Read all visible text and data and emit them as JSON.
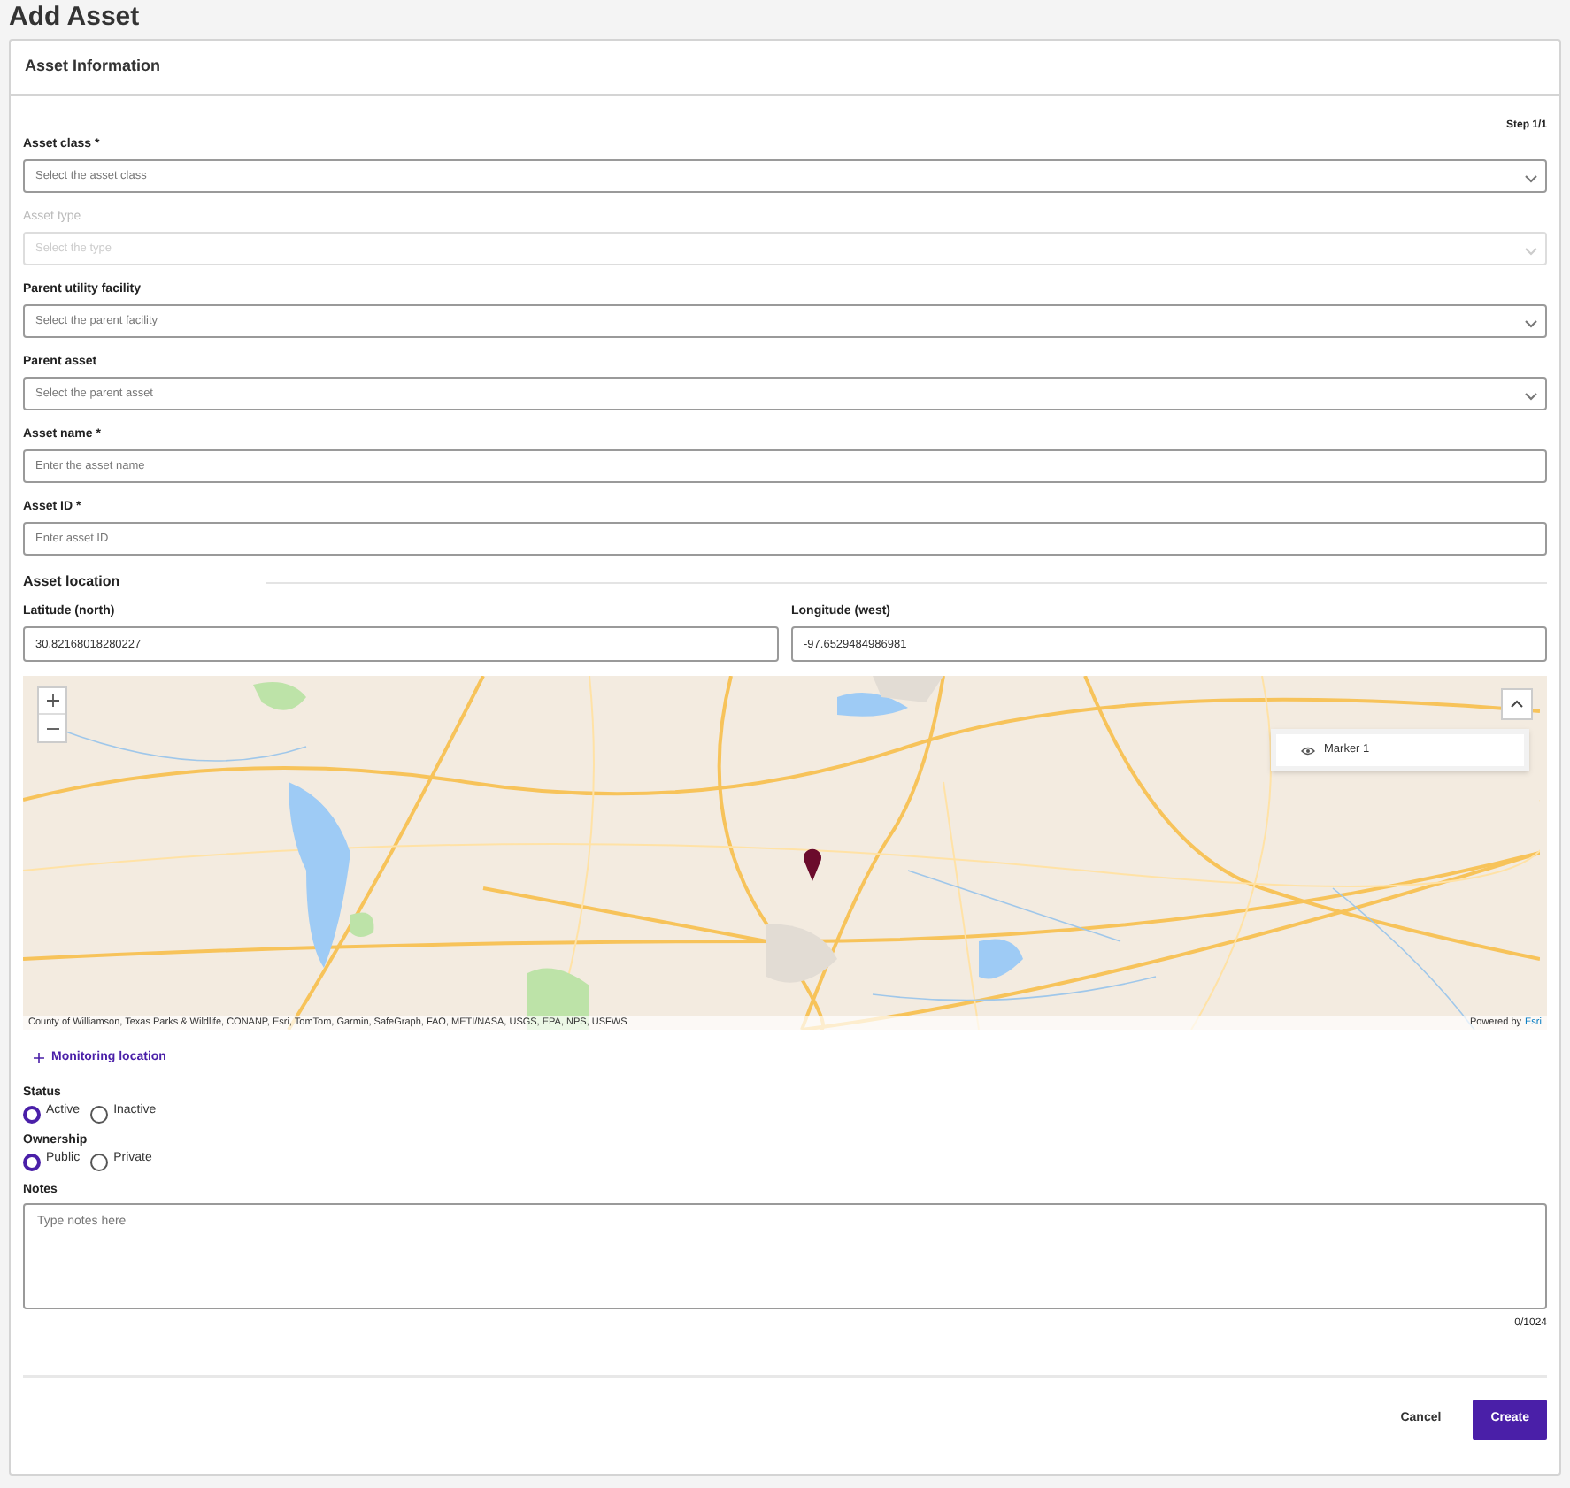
{
  "page_title": "Add Asset",
  "card_title": "Asset Information",
  "step": "Step 1/1",
  "fields": [
    {
      "kind": "select",
      "label": "Asset class *",
      "placeholder": "Select the asset class",
      "disabled": false
    },
    {
      "kind": "select",
      "label": "Asset type",
      "placeholder": "Select the type",
      "disabled": true
    },
    {
      "kind": "select",
      "label": "Parent utility facility",
      "placeholder": "Select the parent facility",
      "disabled": false
    },
    {
      "kind": "select",
      "label": "Parent asset",
      "placeholder": "Select the parent asset",
      "disabled": false
    },
    {
      "kind": "text",
      "label": "Asset name *",
      "placeholder": "Enter the asset name",
      "disabled": false
    },
    {
      "kind": "text",
      "label": "Asset ID *",
      "placeholder": "Enter asset ID",
      "disabled": false
    }
  ],
  "location": {
    "heading": "Asset location",
    "coords": [
      {
        "label": "Latitude (north)",
        "value": "30.82168018280227"
      },
      {
        "label": "Longitude (west)",
        "value": "-97.6529484986981"
      }
    ]
  },
  "map": {
    "layers": [
      {
        "label": "Marker 1"
      }
    ],
    "attribution": "County of Williamson, Texas Parks & Wildlife, CONANP, Esri, TomTom, Garmin, SafeGraph, FAO, METI/NASA, USGS, EPA, NPS, USFWS",
    "powered_by": "Powered by",
    "powered_link": "Esri"
  },
  "add_link": "Monitoring location",
  "radio_groups": [
    {
      "label": "Status",
      "options": [
        {
          "label": "Active",
          "selected": true
        },
        {
          "label": "Inactive",
          "selected": false
        }
      ]
    },
    {
      "label": "Ownership",
      "options": [
        {
          "label": "Public",
          "selected": true
        },
        {
          "label": "Private",
          "selected": false
        }
      ]
    }
  ],
  "notes": {
    "label": "Notes",
    "placeholder": "Type notes here",
    "counter": "0/1024"
  },
  "buttons": [
    {
      "label": "Cancel",
      "kind": "secondary"
    },
    {
      "label": "Create",
      "kind": "primary"
    }
  ]
}
